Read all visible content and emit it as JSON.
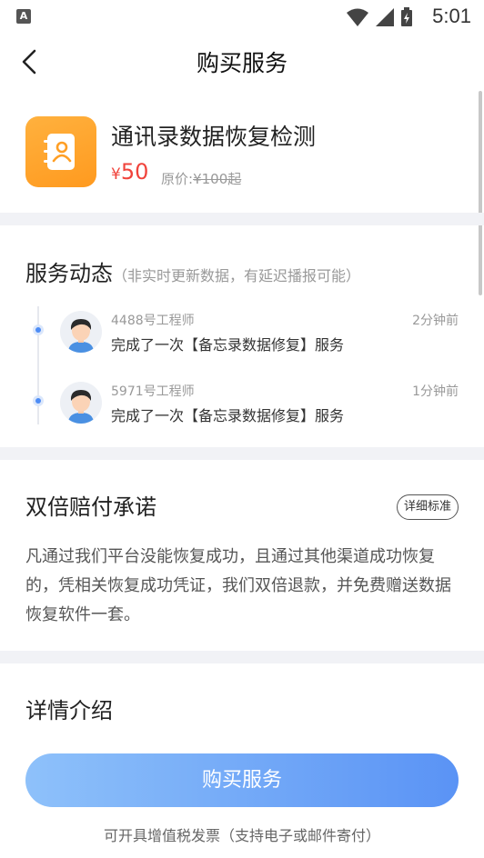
{
  "status_bar": {
    "notification_letter": "A",
    "time": "5:01",
    "icons": [
      "wifi-icon",
      "signal-icon",
      "battery-charging-icon"
    ]
  },
  "nav": {
    "title": "购买服务",
    "back_icon": "back-arrow-icon"
  },
  "product": {
    "icon": "contacts-book-icon",
    "icon_color": "#ffa62b",
    "title": "通讯录数据恢复检测",
    "price_symbol": "¥",
    "price_value": "50",
    "original_price_label": "原价:",
    "original_price_value": "¥100起"
  },
  "dynamics": {
    "title": "服务动态",
    "subtitle": "（非实时更新数据，有延迟播报可能）",
    "items": [
      {
        "engineer": "4488号工程师",
        "action": "完成了一次【备忘录数据修复】服务",
        "time": "2分钟前"
      },
      {
        "engineer": "5971号工程师",
        "action": "完成了一次【备忘录数据修复】服务",
        "time": "1分钟前"
      }
    ]
  },
  "guarantee": {
    "title": "双倍赔付承诺",
    "detail_button": "详细标准",
    "text": "凡通过我们平台没能恢复成功，且通过其他渠道成功恢复的，凭相关恢复成功凭证，我们双倍退款，并免费赠送数据恢复软件一套。"
  },
  "details": {
    "title": "详情介绍"
  },
  "footer": {
    "buy_button": "购买服务",
    "invoice_note": "可开具增值税发票（支持电子或邮件寄付）"
  },
  "colors": {
    "accent_blue": "#5a93f5",
    "price_red": "#f0433b",
    "product_orange": "#ffa62b"
  }
}
